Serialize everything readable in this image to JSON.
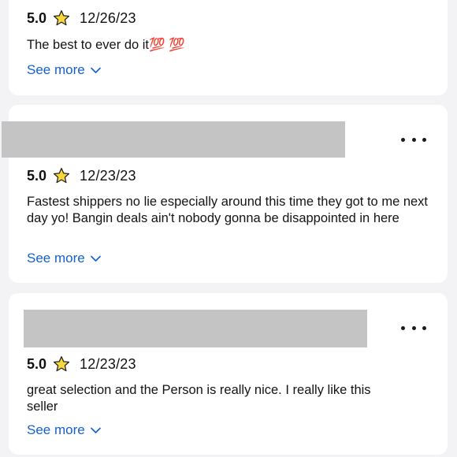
{
  "reviews": [
    {
      "rating": "5.0",
      "date": "12/26/23",
      "text": "The best to ever do it💯 💯",
      "see_more": "See more"
    },
    {
      "rating": "5.0",
      "date": "12/23/23",
      "text": "Fastest shippers no lie especially around this time they got to me next day yo! Bangin deals ain't nobody gonna be disappointed in here",
      "see_more": "See more"
    },
    {
      "rating": "5.0",
      "date": "12/23/23",
      "text": "great selection and the  Person is really nice. I really like this seller",
      "see_more": "See more"
    }
  ],
  "icons": {
    "star": "star-icon",
    "more": "more-options-icon",
    "chevron": "chevron-down-icon"
  },
  "colors": {
    "background": "#f3f3f5",
    "card": "#ffffff",
    "link": "#1560c8",
    "star_fill": "#f8d73a",
    "star_stroke": "#222222",
    "redaction": "#c4c4c4"
  }
}
